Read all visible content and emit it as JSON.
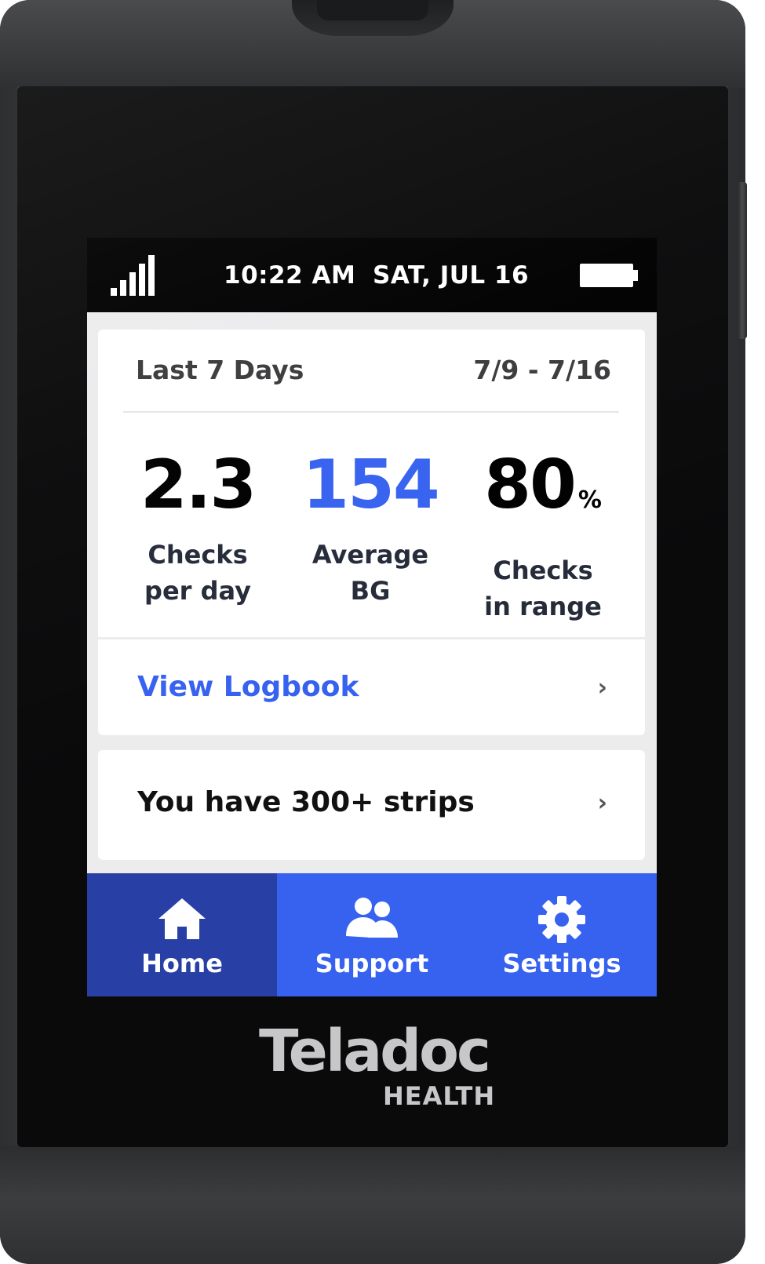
{
  "status_bar": {
    "time": "10:22 AM",
    "date": "SAT, JUL 16",
    "signal_icon": "signal-bars-icon",
    "battery_icon": "battery-full-icon"
  },
  "summary": {
    "title": "Last 7 Days",
    "date_range": "7/9 - 7/16",
    "stats": [
      {
        "value": "2.3",
        "unit": "",
        "label": "Checks\nper day",
        "color": "#000000"
      },
      {
        "value": "154",
        "unit": "",
        "label": "Average\nBG",
        "color": "#3762f0"
      },
      {
        "value": "80",
        "unit": "%",
        "label": "Checks\nin range",
        "color": "#000000"
      }
    ],
    "logbook_link": "View Logbook",
    "chevron": "›"
  },
  "strips": {
    "text": "You have 300+ strips",
    "chevron": "›"
  },
  "nav": {
    "items": [
      {
        "label": "Home",
        "icon": "home-icon",
        "active": true
      },
      {
        "label": "Support",
        "icon": "people-icon",
        "active": false
      },
      {
        "label": "Settings",
        "icon": "gear-icon",
        "active": false
      }
    ]
  },
  "brand": {
    "name": "Teladoc",
    "sub": "HEALTH"
  },
  "colors": {
    "accent": "#3762f0",
    "nav_active": "#2840a6",
    "device_body": "#3a3b3d"
  }
}
